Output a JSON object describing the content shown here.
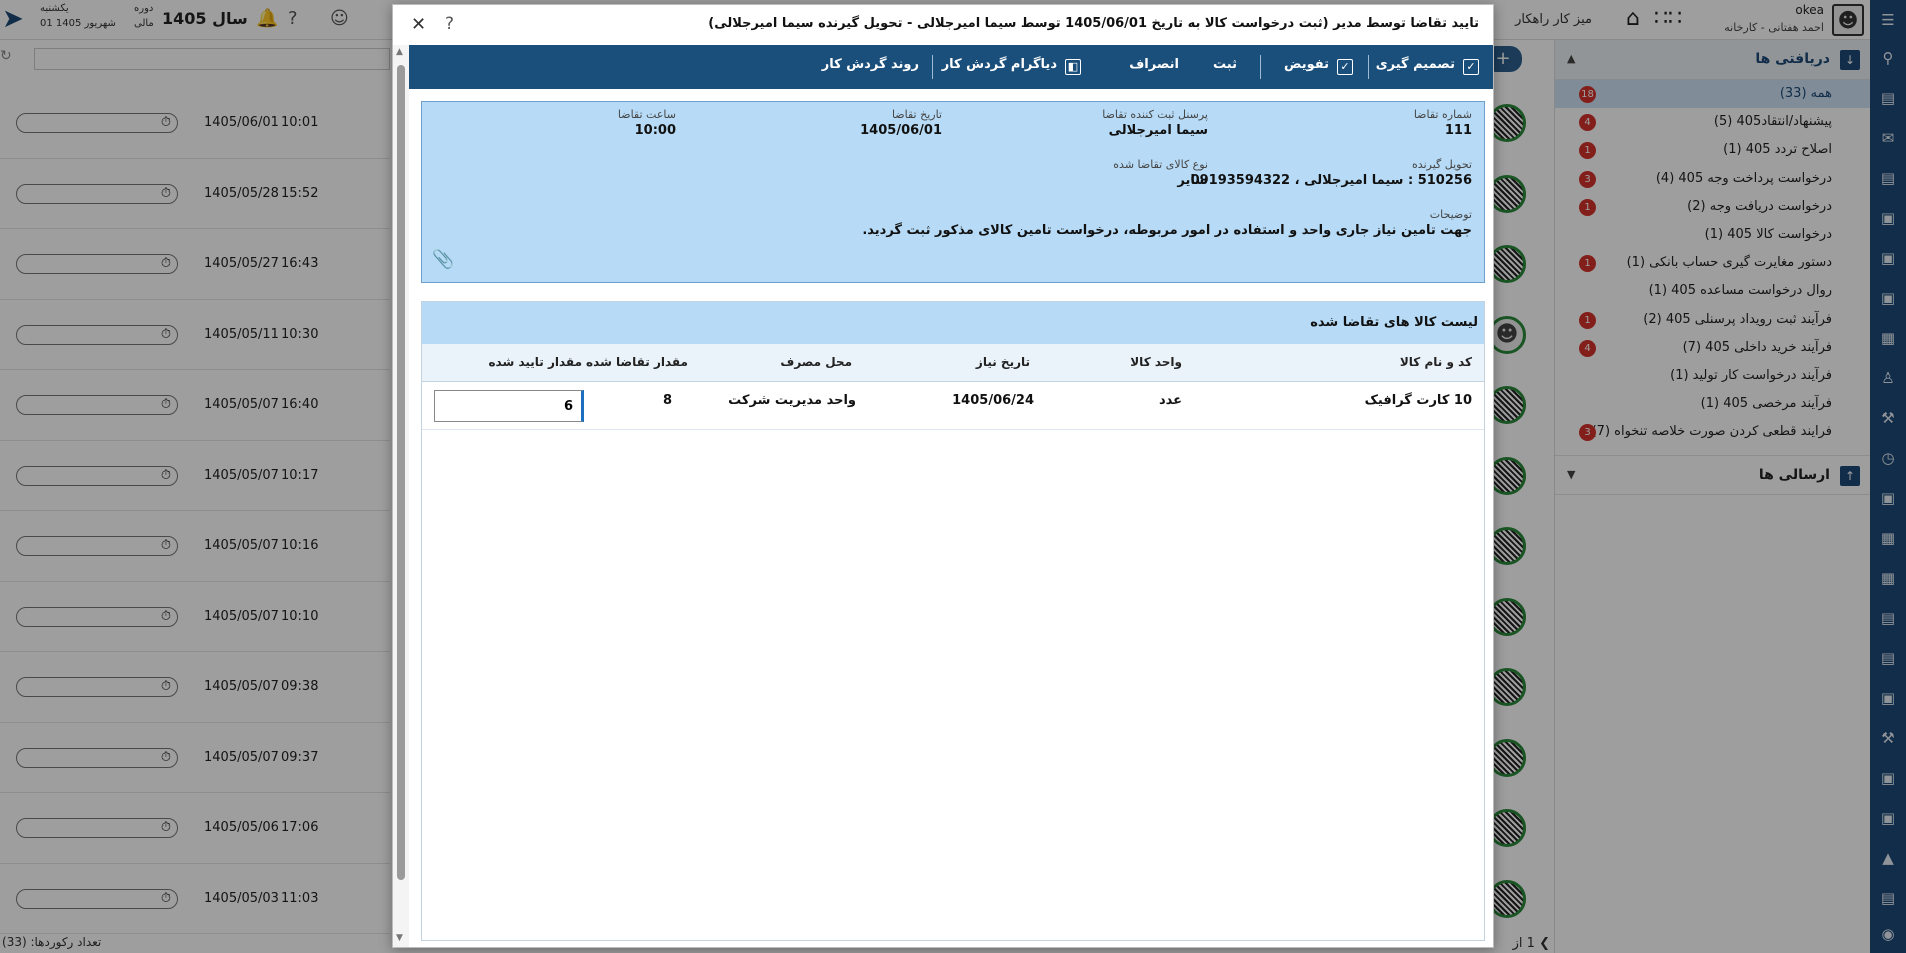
{
  "app": {
    "kartable_title": "میز کار راهکار",
    "user_name": "okea",
    "user_sub": "احمد هفتانی - کارخانه",
    "year_label": "سال 1405",
    "period_label": "دوره",
    "period_sub": "مالی",
    "day_label": "یکشنبه",
    "date_label": "01 شهریور 1405"
  },
  "sidebar": {
    "received_label": "دریافتی ها",
    "sent_label": "ارسالی ها",
    "items": [
      {
        "label": "همه (33)",
        "badge": "18"
      },
      {
        "label": "پیشنهاد/انتقاد405 (5)",
        "badge": "4"
      },
      {
        "label": "اصلاح تردد 405 (1)",
        "badge": "1"
      },
      {
        "label": "درخواست پرداخت وجه 405 (4)",
        "badge": "3"
      },
      {
        "label": "درخواست دریافت وجه (2)",
        "badge": "1"
      },
      {
        "label": "درخواست کالا 405 (1)",
        "badge": ""
      },
      {
        "label": "دستور مغایرت گیری حساب بانکی (1)",
        "badge": "1"
      },
      {
        "label": "روال درخواست مساعده 405 (1)",
        "badge": ""
      },
      {
        "label": "فرآیند ثبت رویداد پرسنلی 405 (2)",
        "badge": "1"
      },
      {
        "label": "فرآیند خرید داخلی 405 (7)",
        "badge": "4"
      },
      {
        "label": "فرآیند درخواست کار تولید (1)",
        "badge": ""
      },
      {
        "label": "فرآیند مرخصی 405 (1)",
        "badge": ""
      },
      {
        "label": "فرایند قطعی کردن صورت خلاصه تنخواه (7)",
        "badge": "3"
      }
    ]
  },
  "list": {
    "rows": [
      {
        "date": "1405/06/01",
        "time": "10:01"
      },
      {
        "date": "1405/05/28",
        "time": "15:52"
      },
      {
        "date": "1405/05/27",
        "time": "16:43"
      },
      {
        "date": "1405/05/11",
        "time": "10:30"
      },
      {
        "date": "1405/05/07",
        "time": "16:40"
      },
      {
        "date": "1405/05/07",
        "time": "10:17"
      },
      {
        "date": "1405/05/07",
        "time": "10:16"
      },
      {
        "date": "1405/05/07",
        "time": "10:10"
      },
      {
        "date": "1405/05/07",
        "time": "09:38"
      },
      {
        "date": "1405/05/07",
        "time": "09:37"
      },
      {
        "date": "1405/05/06",
        "time": "17:06"
      },
      {
        "date": "1405/05/03",
        "time": "11:03"
      }
    ],
    "record_count": "تعداد رکوردها: (33)",
    "page": "1",
    "page_of": "از"
  },
  "modal": {
    "title": "تایید تقاضا توسط مدیر (ثبت درخواست کالا به تاریخ 1405/06/01 توسط سیما امیرجلالی - تحویل گیرنده سیما امیرجلالی)",
    "toolbar": {
      "decide": "تصمیم گیری",
      "delegate": "تفویض",
      "save": "ثبت",
      "cancel": "انصراف",
      "diagram": "دیاگرام گردش کار",
      "flow": "روند گردش کار"
    },
    "fields": {
      "request_no_label": "شماره تقاضا",
      "request_no": "111",
      "registrar_label": "پرسنل ثبت کننده تقاضا",
      "registrar": "سیما امیرجلالی",
      "request_date_label": "تاریخ تقاضا",
      "request_date": "1405/06/01",
      "request_time_label": "ساعت تقاضا",
      "request_time": "10:00",
      "receiver_label": "تحویل گیرنده",
      "receiver": "510256 : سیما امیرجلالی ، 09193594322",
      "goods_type_label": "نوع کالای تقاضا شده",
      "goods_type": "سایر",
      "desc_label": "توضیحات",
      "desc": "جهت تامین نیاز جاری واحد و استفاده در امور مربوطه، درخواست تامین کالای مذکور ثبت گردید."
    },
    "goods": {
      "title": "لیست کالا های تقاضا شده",
      "columns": [
        "کد و نام کالا",
        "واحد کالا",
        "تاریخ نیاز",
        "محل مصرف",
        "مقدار تقاضا شده",
        "مقدار تایید شده"
      ],
      "rows": [
        {
          "name": "10 کارت گرافیک",
          "unit": "عدد",
          "need_date": "1405/06/24",
          "place": "واحد مدیریت شرکت",
          "requested": "8",
          "approved": "6"
        }
      ]
    }
  }
}
